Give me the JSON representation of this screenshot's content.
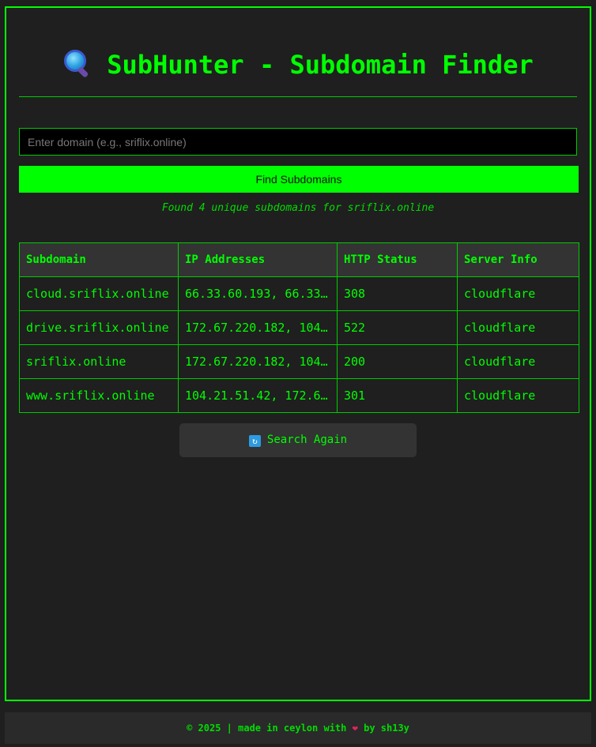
{
  "header": {
    "title": "SubHunter - Subdomain Finder",
    "icon": "magnifying-glass-icon"
  },
  "search": {
    "placeholder": "Enter domain (e.g., sriflix.online)",
    "value": "",
    "button_label": "Find Subdomains"
  },
  "result_message": "Found 4 unique subdomains for sriflix.online",
  "table": {
    "columns": [
      "Subdomain",
      "IP Addresses",
      "HTTP Status",
      "Server Info"
    ],
    "rows": [
      [
        "cloud.sriflix.online",
        "66.33.60.193, 66.33…",
        "308",
        "cloudflare"
      ],
      [
        "drive.sriflix.online",
        "172.67.220.182, 104…",
        "522",
        "cloudflare"
      ],
      [
        "sriflix.online",
        "172.67.220.182, 104…",
        "200",
        "cloudflare"
      ],
      [
        "www.sriflix.online",
        "104.21.51.42, 172.6…",
        "301",
        "cloudflare"
      ]
    ]
  },
  "actions": {
    "search_again_label": "Search Again",
    "search_again_icon": "refresh-icon"
  },
  "footer": {
    "text_before": "© 2025 | made in ceylon with",
    "heart": "❤",
    "text_after": "by sh13y"
  },
  "colors": {
    "accent": "#00ff00",
    "background": "#1f1f1f",
    "header_cell": "#333333"
  }
}
